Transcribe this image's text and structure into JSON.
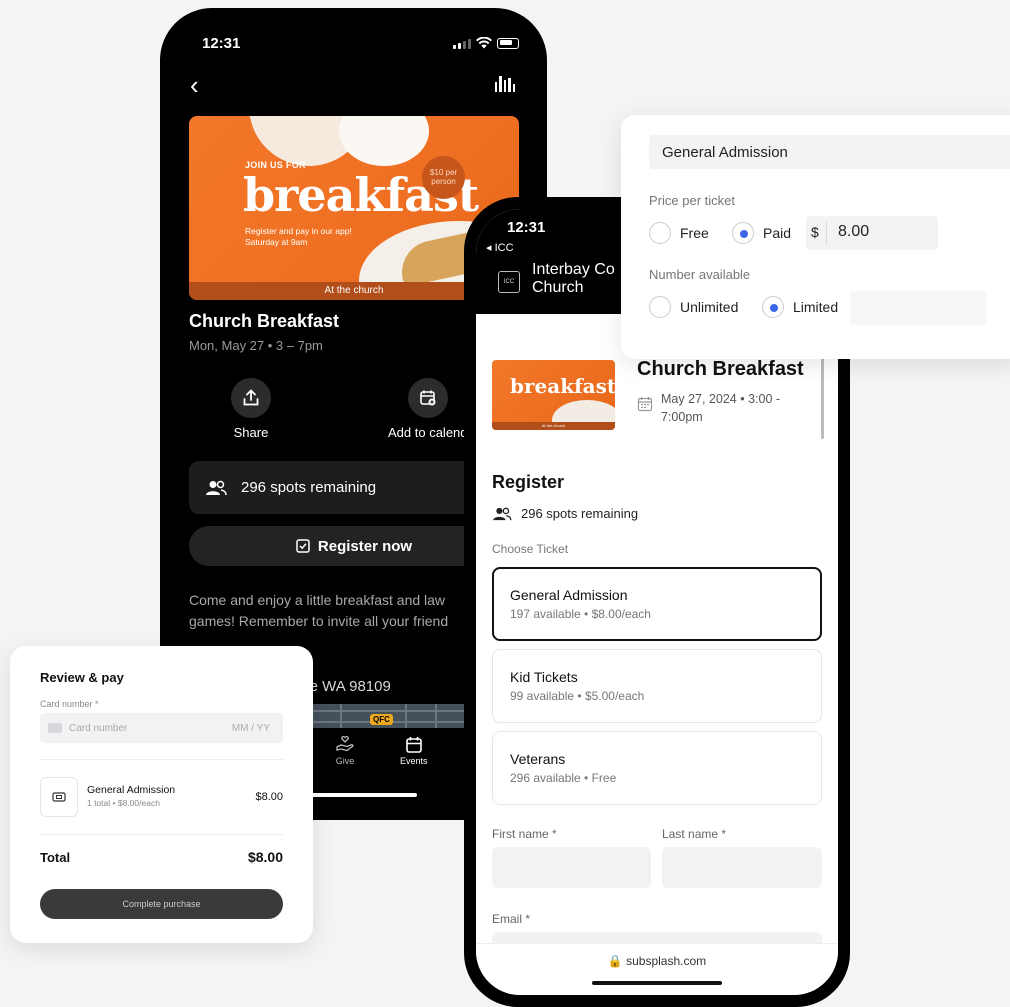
{
  "phone1": {
    "time": "12:31",
    "banner": {
      "join": "JOIN US FOR",
      "headline": "breakfast",
      "sub_line1": "Register and pay in our app!",
      "sub_line2": "Saturday at 9am",
      "badge": "$10 per person",
      "footer": "At the church"
    },
    "event_title": "Church Breakfast",
    "event_date": "Mon, May 27 • 3 – 7pm",
    "actions": {
      "share": "Share",
      "add_to_calendar": "Add to calend"
    },
    "spots_remaining": "296 spots remaining",
    "register_button": "Register now",
    "description": "Come and enjoy a little breakfast and law games! Remember to invite all your friend",
    "address": "ttle WA 98109",
    "map_label": "QFC",
    "tabs": {
      "give": "Give",
      "events": "Events"
    }
  },
  "phone2": {
    "time": "12:31",
    "back_label": "◂ ICC",
    "logo_text": "ICC",
    "church_name_line1": "Interbay Co",
    "church_name_line2": "Church",
    "event_title": "Church Breakfast",
    "event_date": "May 27, 2024 • 3:00 - 7:00pm",
    "thumb_headline": "breakfast",
    "thumb_footer": "At the church",
    "register_heading": "Register",
    "spots_remaining": "296 spots remaining",
    "choose_ticket": "Choose Ticket",
    "tickets": [
      {
        "name": "General Admission",
        "info": "197 available • $8.00/each",
        "selected": true
      },
      {
        "name": "Kid Tickets",
        "info": "99 available • $5.00/each",
        "selected": false
      },
      {
        "name": "Veterans",
        "info": "296 available • Free",
        "selected": false
      }
    ],
    "first_name_label": "First name *",
    "last_name_label": "Last name *",
    "email_label": "Email *",
    "url": "🔒 subsplash.com"
  },
  "ticket_config": {
    "name_value": "General Admission",
    "price_label": "Price per ticket",
    "free_label": "Free",
    "paid_label": "Paid",
    "currency": "$",
    "price_value": "8.00",
    "price_mode": "paid",
    "number_label": "Number available",
    "unlimited_label": "Unlimited",
    "limited_label": "Limited",
    "number_mode": "limited",
    "accent_color": "#3b66e8"
  },
  "review_pay": {
    "title": "Review & pay",
    "card_number_label": "Card number *",
    "card_number_placeholder": "Card number",
    "expiry_placeholder": "MM / YY",
    "item_name": "General Admission",
    "item_info": "1 total • $8.00/each",
    "item_price": "$8.00",
    "total_label": "Total",
    "total_value": "$8.00",
    "complete_button": "Complete purchase"
  }
}
